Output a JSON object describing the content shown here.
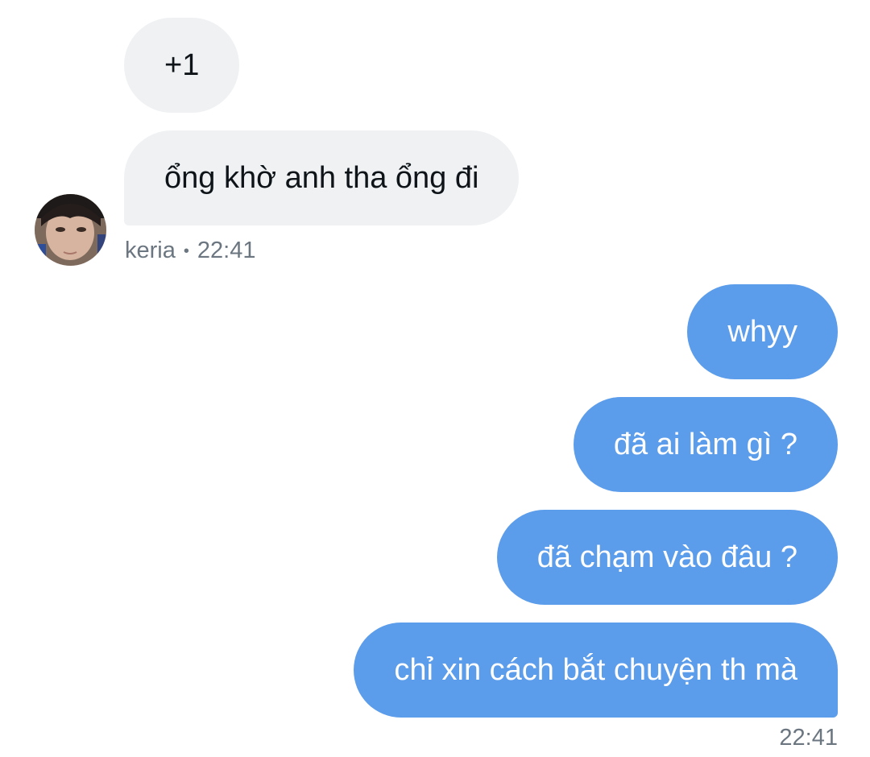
{
  "incoming": {
    "messages": [
      "+1",
      "ổng khờ anh tha ổng đi"
    ],
    "sender": "keria",
    "separator": "•",
    "time": "22:41",
    "avatar": "user-avatar-photo"
  },
  "outgoing": {
    "messages": [
      "whyy",
      "đã ai làm gì ?",
      "đã chạm vào đâu ?",
      "chỉ xin cách bắt chuyện th mà"
    ],
    "time": "22:41"
  },
  "colors": {
    "incoming_bubble": "#eff1f3",
    "outgoing_bubble": "#5b9ceb",
    "meta_text": "#6b7680"
  }
}
